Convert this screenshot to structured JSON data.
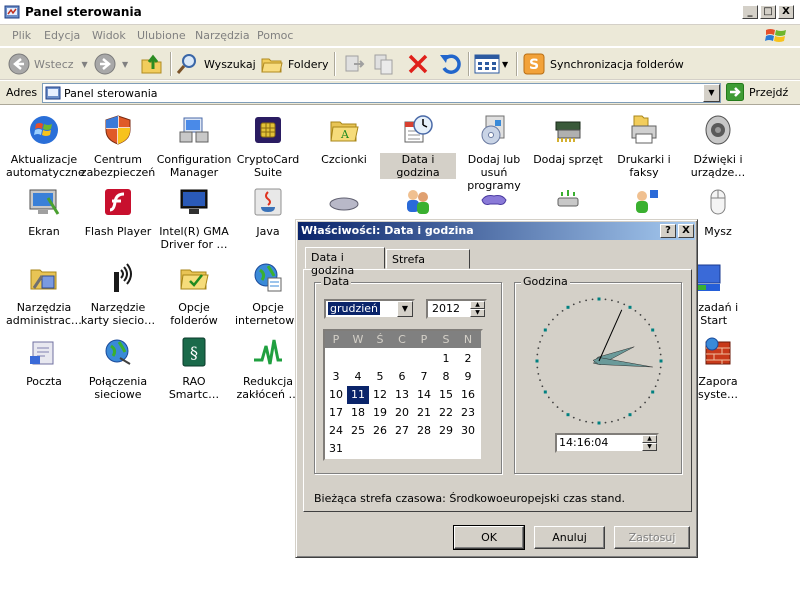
{
  "window": {
    "title": "Panel sterowania",
    "caption_min": "_",
    "caption_max": "□",
    "caption_close": "X"
  },
  "menu": [
    "Plik",
    "Edycja",
    "Widok",
    "Ulubione",
    "Narzędzia",
    "Pomoc"
  ],
  "toolbar": {
    "back_label": "Wstecz",
    "search_label": "Wyszukaj",
    "folders_label": "Foldery",
    "sync_label": "Synchronizacja folderów"
  },
  "address": {
    "label": "Adres",
    "value": "Panel sterowania",
    "go_label": "Przejdź"
  },
  "icons": [
    {
      "label": "Aktualizacje\nautomatyczne",
      "icon": "windows-update-icon"
    },
    {
      "label": "Centrum\nzabezpieczeń",
      "icon": "security-shield-icon"
    },
    {
      "label": "Configuration\nManager",
      "icon": "configuration-manager-icon"
    },
    {
      "label": "CryptoCard\nSuite",
      "icon": "cryptocard-icon"
    },
    {
      "label": "Czcionki",
      "icon": "fonts-folder-icon"
    },
    {
      "label": "Data i godzina",
      "icon": "date-time-icon"
    },
    {
      "label": "Dodaj lub usuń\nprogramy",
      "icon": "add-remove-programs-icon"
    },
    {
      "label": "Dodaj sprzęt",
      "icon": "add-hardware-icon"
    },
    {
      "label": "Drukarki i\nfaksy",
      "icon": "printers-icon"
    },
    {
      "label": "Dźwięki i\nurządze…",
      "icon": "sounds-icon"
    },
    {
      "label": "Ekran",
      "icon": "display-icon"
    },
    {
      "label": "Flash Player",
      "icon": "flash-player-icon"
    },
    {
      "label": "Intel(R) GMA\nDriver for …",
      "icon": "intel-gma-icon"
    },
    {
      "label": "Java",
      "icon": "java-icon"
    },
    {
      "label": "",
      "icon": "keyboard-icon"
    },
    {
      "label": "",
      "icon": "user-accounts-icon"
    },
    {
      "label": "",
      "icon": "game-controller-icon"
    },
    {
      "label": "",
      "icon": "usb-device-icon"
    },
    {
      "label": "",
      "icon": "network-user-icon"
    },
    {
      "label": "Mysz",
      "icon": "mouse-icon"
    },
    {
      "label": "Narzędzia\nadministrac…",
      "icon": "admin-tools-icon"
    },
    {
      "label": "Narzędzie\nkarty siecio…",
      "icon": "network-card-tool-icon"
    },
    {
      "label": "Opcje\nfolderów",
      "icon": "folder-options-icon"
    },
    {
      "label": "Opcje\ninternetowe",
      "icon": "internet-options-icon"
    },
    {
      "label": "sek zadań i\nenu Start",
      "icon": "taskbar-start-menu-icon"
    },
    {
      "label": "Poczta",
      "icon": "mail-icon"
    },
    {
      "label": "Połączenia\nsieciowe",
      "icon": "network-connections-icon"
    },
    {
      "label": "RAO\nSmartc…",
      "icon": "rao-smartcard-icon"
    },
    {
      "label": "Redukcja\nzakłóceń …",
      "icon": "noise-reduction-icon"
    },
    {
      "label": "Zapora\nsyste…",
      "icon": "firewall-icon"
    }
  ],
  "dialog": {
    "title": "Właściwości: Data i godzina",
    "help": "?",
    "close": "X",
    "tabs": [
      "Data i godzina",
      "Strefa czasowa"
    ],
    "date_group": "Data",
    "month": "grudzień",
    "year": "2012",
    "weekdays": [
      "P",
      "W",
      "Ś",
      "C",
      "P",
      "S",
      "N"
    ],
    "selected_day": "11",
    "time_group": "Godzina",
    "time": "14:16:04",
    "clock": {
      "hours": 14,
      "minutes": 16,
      "seconds": 4
    },
    "timezone_text": "Bieżąca strefa czasowa: Środkowoeuropejski czas stand.",
    "ok": "OK",
    "cancel": "Anuluj",
    "apply": "Zastosuj"
  },
  "colors": {
    "dialog_title_start": "#0a246a",
    "dialog_title_end": "#a6caf0",
    "selection": "#0a246a",
    "face": "#d4d0c8"
  }
}
